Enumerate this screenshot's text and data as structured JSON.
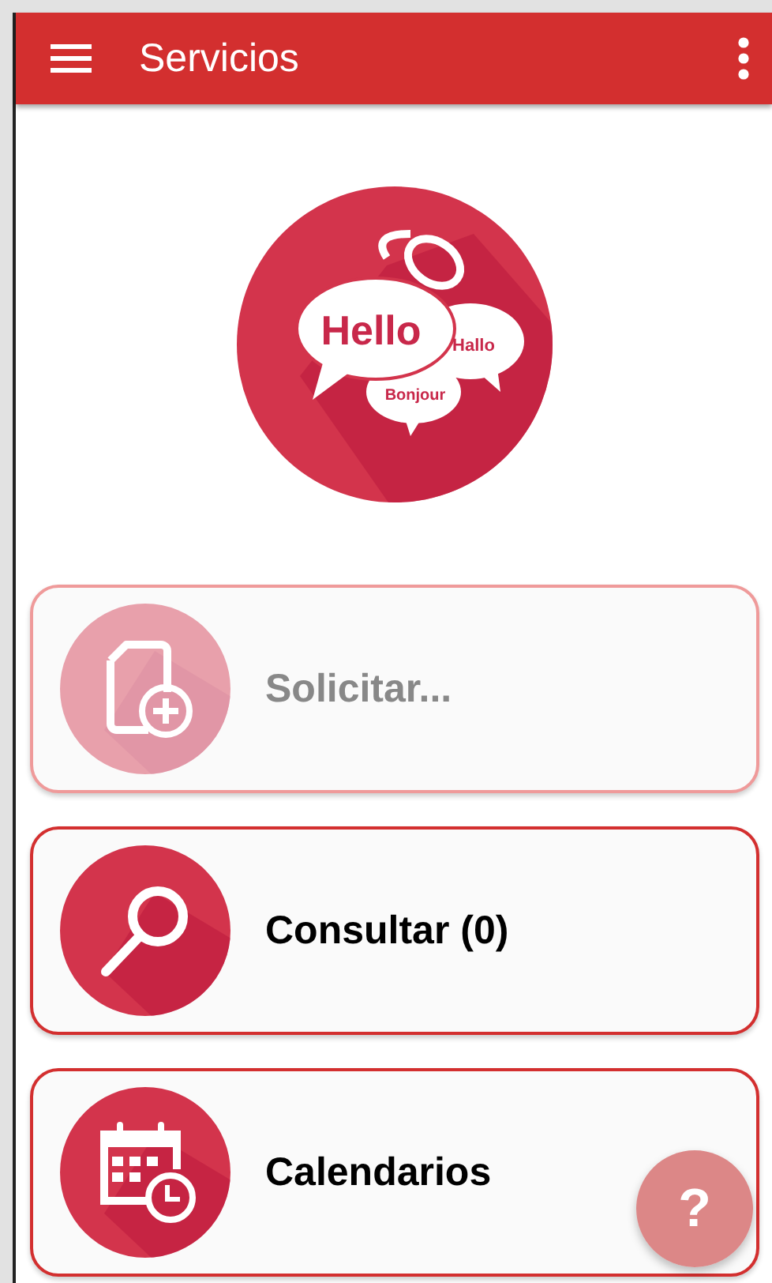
{
  "app_bar": {
    "title": "Servicios"
  },
  "logo": {
    "words": [
      "Hello",
      "Hallo",
      "Bonjour"
    ]
  },
  "services": [
    {
      "kind": "request",
      "label": "Solicitar...",
      "disabled": true
    },
    {
      "kind": "search",
      "label": "Consultar (0)",
      "disabled": false
    },
    {
      "kind": "calendar",
      "label": "Calendarios",
      "disabled": false
    }
  ],
  "help_button": {
    "label": "?"
  }
}
